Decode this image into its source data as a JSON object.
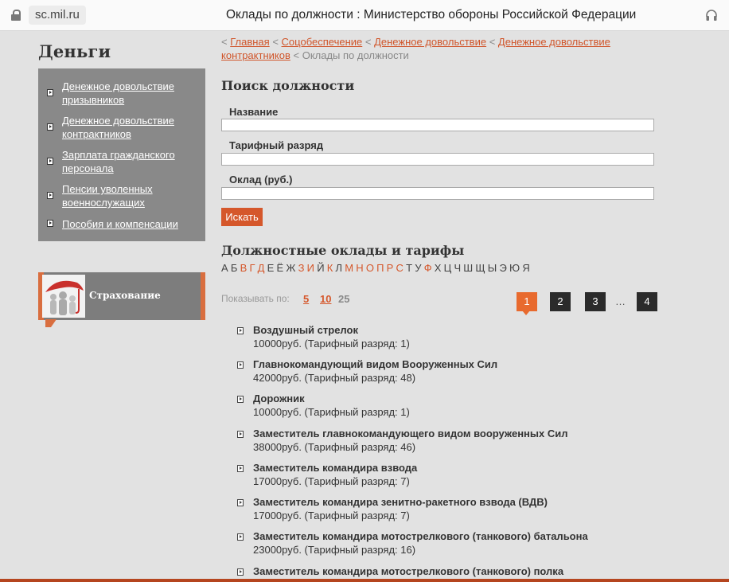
{
  "browser": {
    "url": "sc.mil.ru",
    "title": "Оклады по должности : Министерство обороны Российской Федерации"
  },
  "sidebar": {
    "title": "Деньги",
    "items": [
      {
        "label": "Денежное довольствие призывников"
      },
      {
        "label": "Денежное довольствие контрактников"
      },
      {
        "label": "Зарплата гражданского персонала"
      },
      {
        "label": "Пенсии уволенных военнослужащих"
      },
      {
        "label": "Пособия и компенсации"
      }
    ],
    "insurance_label": "Страхование"
  },
  "breadcrumb": {
    "sep": "<",
    "links": [
      "Главная",
      "Соцобеспечение",
      "Денежное довольствие",
      "Денежное довольствие контрактников"
    ],
    "current": "Оклады по должности"
  },
  "search": {
    "heading": "Поиск должности",
    "name_label": "Название",
    "grade_label": "Тарифный разряд",
    "salary_label": "Оклад (руб.)",
    "name_value": "",
    "grade_value": "",
    "salary_value": "",
    "button": "Искать"
  },
  "salaries": {
    "heading": "Должностные оклады и тарифы",
    "alphabet": [
      {
        "l": "А",
        "on": false
      },
      {
        "l": "Б",
        "on": false
      },
      {
        "l": "В",
        "on": true
      },
      {
        "l": "Г",
        "on": true
      },
      {
        "l": "Д",
        "on": true
      },
      {
        "l": "Е",
        "on": false
      },
      {
        "l": "Ё",
        "on": false
      },
      {
        "l": "Ж",
        "on": false
      },
      {
        "l": "З",
        "on": true
      },
      {
        "l": "И",
        "on": true
      },
      {
        "l": "Й",
        "on": false
      },
      {
        "l": "К",
        "on": true
      },
      {
        "l": "Л",
        "on": false
      },
      {
        "l": "М",
        "on": true
      },
      {
        "l": "Н",
        "on": true
      },
      {
        "l": "О",
        "on": true
      },
      {
        "l": "П",
        "on": true
      },
      {
        "l": "Р",
        "on": true
      },
      {
        "l": "С",
        "on": true
      },
      {
        "l": "Т",
        "on": false
      },
      {
        "l": "У",
        "on": false
      },
      {
        "l": "Ф",
        "on": true
      },
      {
        "l": "Х",
        "on": false
      },
      {
        "l": "Ц",
        "on": false
      },
      {
        "l": "Ч",
        "on": false
      },
      {
        "l": "Ш",
        "on": false
      },
      {
        "l": "Щ",
        "on": false
      },
      {
        "l": "Ы",
        "on": false
      },
      {
        "l": "Э",
        "on": false
      },
      {
        "l": "Ю",
        "on": false
      },
      {
        "l": "Я",
        "on": false
      }
    ],
    "show_by_label": "Показывать по:",
    "show_by": [
      "5",
      "10",
      "25"
    ],
    "pages": [
      "1",
      "2",
      "3",
      "4"
    ],
    "active_page": "1",
    "ellipsis": "…",
    "items": [
      {
        "name": "Воздушный стрелок",
        "detail": "10000руб. (Тарифный разряд: 1)"
      },
      {
        "name": "Главнокомандующий видом Вооруженных Сил",
        "detail": "42000руб. (Тарифный разряд: 48)"
      },
      {
        "name": "Дорожник",
        "detail": "10000руб. (Тарифный разряд: 1)"
      },
      {
        "name": "Заместитель главнокомандующего видом вооруженных Сил",
        "detail": "38000руб. (Тарифный разряд: 46)"
      },
      {
        "name": "Заместитель командира взвода",
        "detail": "17000руб. (Тарифный разряд: 7)"
      },
      {
        "name": "Заместитель командира зенитно-ракетного взвода (ВДВ)",
        "detail": "17000руб. (Тарифный разряд: 7)"
      },
      {
        "name": "Заместитель командира мотострелкового (танкового) батальона",
        "detail": "23000руб. (Тарифный разряд: 16)"
      },
      {
        "name": "Заместитель командира мотострелкового (танкового) полка",
        "detail": ""
      }
    ]
  },
  "colors": {
    "accent": "#d5572b",
    "menu_bg": "#898989",
    "page_bg": "#e2e2e2"
  }
}
